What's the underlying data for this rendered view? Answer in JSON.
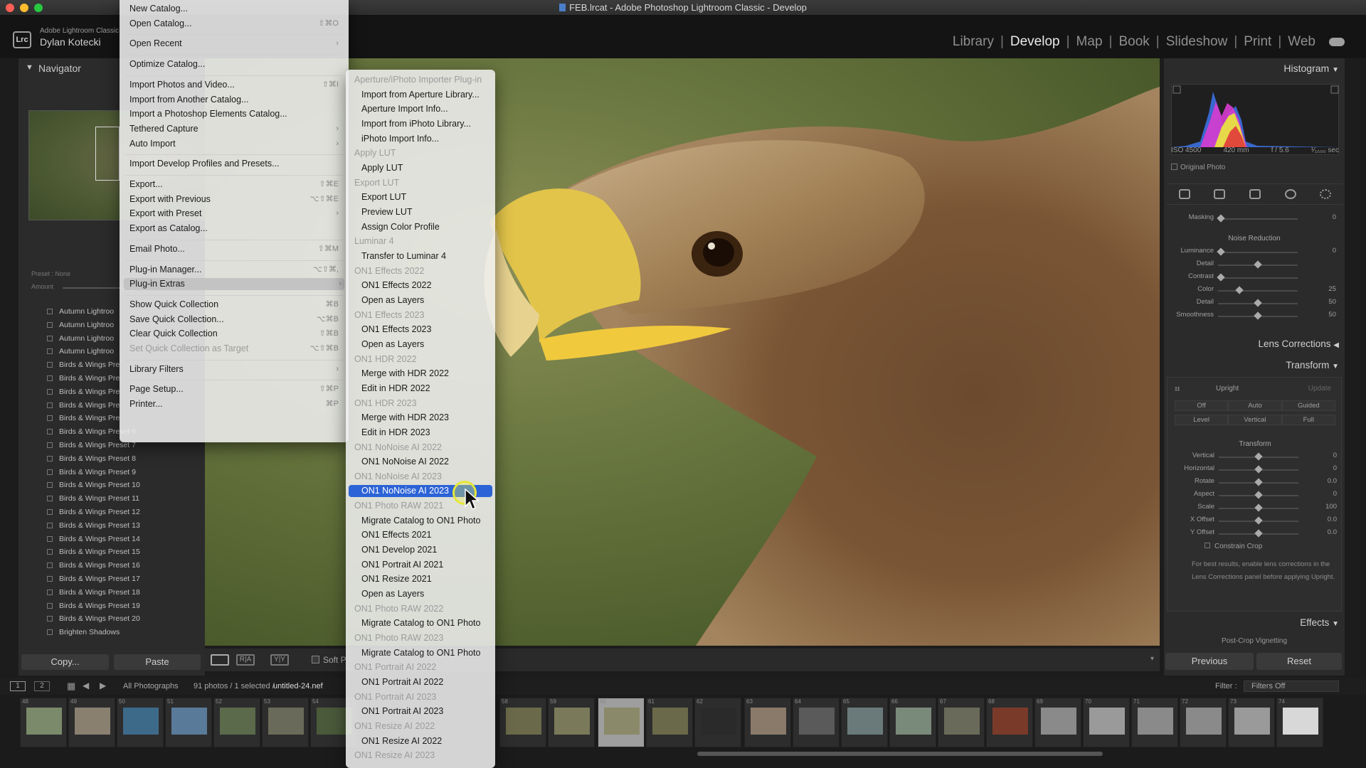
{
  "window": {
    "title": "FEB.lrcat - Adobe Photoshop Lightroom Classic - Develop"
  },
  "identity": {
    "app": "Adobe Lightroom Classic",
    "user": "Dylan Kotecki",
    "logo": "Lrc"
  },
  "modules": [
    "Library",
    "Develop",
    "Map",
    "Book",
    "Slideshow",
    "Print",
    "Web"
  ],
  "active_module": "Develop",
  "left_panel": {
    "navigator_label": "Navigator",
    "preset_label": "Preset : None",
    "amount_label": "Amount",
    "presets": [
      "Autumn Lightroo",
      "Autumn Lightroo",
      "Autumn Lightroo",
      "Autumn Lightroo",
      "Birds & Wings Pre",
      "Birds & Wings Pre",
      "Birds & Wings Pre",
      "Birds & Wings Pre",
      "Birds & Wings Pre",
      "Birds & Wings Preset 6",
      "Birds & Wings Preset 7",
      "Birds & Wings Preset 8",
      "Birds & Wings Preset 9",
      "Birds & Wings Preset 10",
      "Birds & Wings Preset 11",
      "Birds & Wings Preset 12",
      "Birds & Wings Preset 13",
      "Birds & Wings Preset 14",
      "Birds & Wings Preset 15",
      "Birds & Wings Preset 16",
      "Birds & Wings Preset 17",
      "Birds & Wings Preset 18",
      "Birds & Wings Preset 19",
      "Birds & Wings Preset 20",
      "Brighten Shadows"
    ],
    "copy_label": "Copy...",
    "paste_label": "Paste"
  },
  "toolbar": {
    "soft_proof": "Soft P"
  },
  "file_menu": [
    {
      "label": "New Catalog...",
      "shortcut": ""
    },
    {
      "label": "Open Catalog...",
      "shortcut": "⇧⌘O"
    },
    {
      "sep": true
    },
    {
      "label": "Open Recent",
      "shortcut": "›"
    },
    {
      "sep": true
    },
    {
      "label": "Optimize Catalog...",
      "shortcut": ""
    },
    {
      "sep": true
    },
    {
      "label": "Import Photos and Video...",
      "shortcut": "⇧⌘I"
    },
    {
      "label": "Import from Another Catalog...",
      "shortcut": ""
    },
    {
      "label": "Import a Photoshop Elements Catalog...",
      "shortcut": ""
    },
    {
      "label": "Tethered Capture",
      "shortcut": "›"
    },
    {
      "label": "Auto Import",
      "shortcut": "›"
    },
    {
      "sep": true
    },
    {
      "label": "Import Develop Profiles and Presets...",
      "shortcut": ""
    },
    {
      "sep": true
    },
    {
      "label": "Export...",
      "shortcut": "⇧⌘E"
    },
    {
      "label": "Export with Previous",
      "shortcut": "⌥⇧⌘E"
    },
    {
      "label": "Export with Preset",
      "shortcut": "›"
    },
    {
      "label": "Export as Catalog...",
      "shortcut": ""
    },
    {
      "sep": true
    },
    {
      "label": "Email Photo...",
      "shortcut": "⇧⌘M"
    },
    {
      "sep": true
    },
    {
      "label": "Plug-in Manager...",
      "shortcut": "⌥⇧⌘,"
    },
    {
      "label": "Plug-in Extras",
      "shortcut": "›",
      "highlight": true
    },
    {
      "sep": true
    },
    {
      "label": "Show Quick Collection",
      "shortcut": "⌘B"
    },
    {
      "label": "Save Quick Collection...",
      "shortcut": "⌥⌘B"
    },
    {
      "label": "Clear Quick Collection",
      "shortcut": "⇧⌘B"
    },
    {
      "label": "Set Quick Collection as Target",
      "shortcut": "⌥⇧⌘B",
      "disabled": true
    },
    {
      "sep": true
    },
    {
      "label": "Library Filters",
      "shortcut": "›"
    },
    {
      "sep": true
    },
    {
      "label": "Page Setup...",
      "shortcut": "⇧⌘P"
    },
    {
      "label": "Printer...",
      "shortcut": "⌘P"
    }
  ],
  "plugin_extras_menu": [
    {
      "label": "Aperture/iPhoto Importer Plug-in",
      "header": true
    },
    {
      "label": "Import from Aperture Library..."
    },
    {
      "label": "Aperture Import Info..."
    },
    {
      "label": "Import from iPhoto Library..."
    },
    {
      "label": "iPhoto Import Info..."
    },
    {
      "label": "Apply LUT",
      "header": true
    },
    {
      "label": "Apply LUT"
    },
    {
      "label": "Export LUT",
      "header": true
    },
    {
      "label": "Export LUT"
    },
    {
      "label": "Preview LUT"
    },
    {
      "label": "Assign Color Profile"
    },
    {
      "label": "Luminar 4",
      "header": true
    },
    {
      "label": "Transfer to Luminar 4"
    },
    {
      "label": "ON1 Effects 2022",
      "header": true
    },
    {
      "label": "ON1 Effects 2022"
    },
    {
      "label": "Open as Layers"
    },
    {
      "label": "ON1 Effects 2023",
      "header": true
    },
    {
      "label": "ON1 Effects 2023"
    },
    {
      "label": "Open as Layers"
    },
    {
      "label": "ON1 HDR 2022",
      "header": true
    },
    {
      "label": "Merge with HDR 2022"
    },
    {
      "label": "Edit in HDR 2022"
    },
    {
      "label": "ON1 HDR 2023",
      "header": true
    },
    {
      "label": "Merge with HDR 2023"
    },
    {
      "label": "Edit in HDR 2023"
    },
    {
      "label": "ON1 NoNoise AI 2022",
      "header": true
    },
    {
      "label": "ON1 NoNoise AI 2022"
    },
    {
      "label": "ON1 NoNoise AI 2023",
      "header": true
    },
    {
      "label": "ON1 NoNoise AI 2023",
      "highlight": true
    },
    {
      "label": "ON1 Photo RAW 2021",
      "header": true
    },
    {
      "label": "Migrate Catalog to ON1 Photo"
    },
    {
      "label": "ON1 Effects 2021"
    },
    {
      "label": "ON1 Develop 2021"
    },
    {
      "label": "ON1 Portrait AI 2021"
    },
    {
      "label": "ON1 Resize 2021"
    },
    {
      "label": "Open as Layers"
    },
    {
      "label": "ON1 Photo RAW 2022",
      "header": true
    },
    {
      "label": "Migrate Catalog to ON1 Photo"
    },
    {
      "label": "ON1 Photo RAW 2023",
      "header": true
    },
    {
      "label": "Migrate Catalog to ON1 Photo"
    },
    {
      "label": "ON1 Portrait AI 2022",
      "header": true
    },
    {
      "label": "ON1 Portrait AI 2022"
    },
    {
      "label": "ON1 Portrait AI 2023",
      "header": true
    },
    {
      "label": "ON1 Portrait AI 2023"
    },
    {
      "label": "ON1 Resize AI 2022",
      "header": true
    },
    {
      "label": "ON1 Resize AI 2022"
    },
    {
      "label": "ON1 Resize AI 2023",
      "header": true
    }
  ],
  "right_panel": {
    "histogram_label": "Histogram",
    "iso": "ISO 4500",
    "focal": "420 mm",
    "aperture": "f / 5.6",
    "shutter": "¹⁄₁₆₀₀ sec",
    "original_photo": "Original Photo",
    "masking_label": "Masking",
    "masking_value": "0",
    "noise_reduction": "Noise Reduction",
    "nr_sliders": [
      {
        "label": "Luminance",
        "value": "0",
        "pos": 0
      },
      {
        "label": "Detail",
        "value": "",
        "pos": 0.5
      },
      {
        "label": "Contrast",
        "value": "",
        "pos": 0
      },
      {
        "label": "Color",
        "value": "25",
        "pos": 0.25
      },
      {
        "label": "Detail",
        "value": "50",
        "pos": 0.5
      },
      {
        "label": "Smoothness",
        "value": "50",
        "pos": 0.5
      }
    ],
    "lens_corrections": "Lens Corrections",
    "transform_label": "Transform",
    "upright": "Upright",
    "update": "Update",
    "upright_buttons_1": [
      "Off",
      "Auto",
      "Guided"
    ],
    "upright_buttons_2": [
      "Level",
      "Vertical",
      "Full"
    ],
    "transform_sub": "Transform",
    "transform_sliders": [
      {
        "label": "Vertical",
        "value": "0",
        "pos": 0.5
      },
      {
        "label": "Horizontal",
        "value": "0",
        "pos": 0.5
      },
      {
        "label": "Rotate",
        "value": "0.0",
        "pos": 0.5
      },
      {
        "label": "Aspect",
        "value": "0",
        "pos": 0.5
      },
      {
        "label": "Scale",
        "value": "100",
        "pos": 0.5
      },
      {
        "label": "X Offset",
        "value": "0.0",
        "pos": 0.5
      },
      {
        "label": "Y Offset",
        "value": "0.0",
        "pos": 0.5
      }
    ],
    "constrain_crop": "Constrain Crop",
    "hint": "For best results, enable lens corrections in the Lens Corrections panel before applying Upright.",
    "effects": "Effects",
    "post_crop": "Post-Crop Vignetting",
    "previous": "Previous",
    "reset": "Reset"
  },
  "filmbar": {
    "page1": "1",
    "page2": "2",
    "source": "All Photographs",
    "count": "91 photos / 1 selected /",
    "file": "untitled-24.nef",
    "filter_label": "Filter :",
    "filter_value": "Filters Off"
  },
  "filmstrip_numbers": [
    "48",
    "49",
    "50",
    "51",
    "52",
    "53",
    "54",
    "58",
    "59",
    "60",
    "61",
    "62",
    "63",
    "64",
    "65",
    "66",
    "67",
    "68",
    "69",
    "70",
    "71",
    "72",
    "73",
    "74"
  ],
  "colors": {
    "highlight_blue": "#2c63d6",
    "cursor_yellow": "#e6e63a",
    "menu_bg": "#eeeeee"
  }
}
